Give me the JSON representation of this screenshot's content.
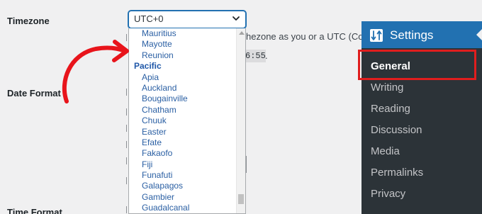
{
  "form": {
    "timezone_label": "Timezone",
    "timezone_value": "UTC+0",
    "timezone_desc": "hezone as you or a UTC (Coordinate",
    "universal_time_code": "6:55",
    "universal_time_suffix": ".",
    "date_format_label": "Date Format",
    "time_format_label": "Time Format"
  },
  "dropdown": {
    "options_before": [
      "Mauritius",
      "Mayotte",
      "Reunion"
    ],
    "group_label": "Pacific",
    "group_options": [
      "Apia",
      "Auckland",
      "Bougainville",
      "Chatham",
      "Chuuk",
      "Easter",
      "Efate",
      "Fakaofo",
      "Fiji",
      "Funafuti",
      "Galapagos",
      "Gambier",
      "Guadalcanal"
    ]
  },
  "admin_menu": {
    "header_label": "Settings",
    "items": [
      "General",
      "Writing",
      "Reading",
      "Discussion",
      "Media",
      "Permalinks",
      "Privacy"
    ],
    "current_item": "General"
  },
  "colors": {
    "accent": "#2271b1",
    "menu_bg": "#1d2327",
    "submenu_bg": "#2c3338",
    "highlight_red": "#e01e1e",
    "option_blue": "#2a5fa3"
  },
  "icons": {
    "select_chevron": "chevron-down-icon",
    "settings": "settings-sliders-icon",
    "arrow": "curved-arrow-icon"
  }
}
